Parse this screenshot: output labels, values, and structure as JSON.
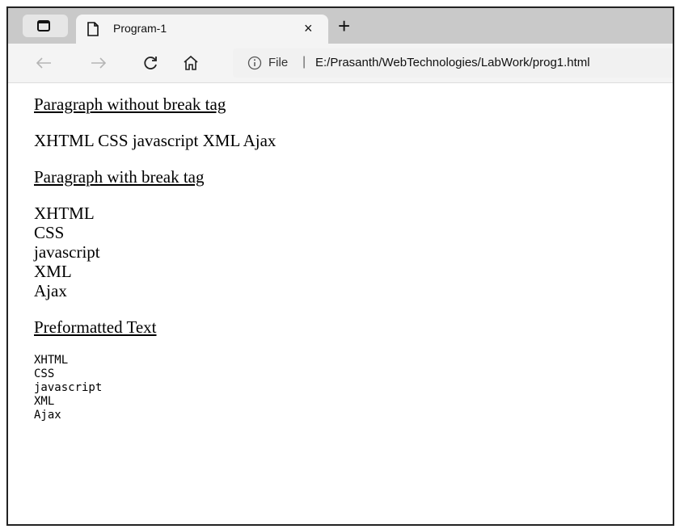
{
  "tab": {
    "title": "Program-1",
    "close": "×",
    "new_tab": "+"
  },
  "address_bar": {
    "scheme_label": "File",
    "separator": "|",
    "url": "E:/Prasanth/WebTechnologies/LabWork/prog1.html"
  },
  "icons": [
    "tab-actions-icon",
    "page-icon",
    "back-arrow-icon",
    "forward-arrow-icon",
    "refresh-icon",
    "home-icon",
    "info-icon"
  ],
  "document": {
    "heading1": "Paragraph without break tag",
    "paragraph1": "XHTML CSS javascript XML Ajax",
    "heading2": "Paragraph with break tag",
    "lines": [
      "XHTML",
      "CSS",
      "javascript",
      "XML",
      "Ajax"
    ],
    "heading3": "Preformatted Text",
    "pre": [
      "XHTML",
      "CSS",
      "javascript",
      "XML",
      "Ajax"
    ]
  }
}
